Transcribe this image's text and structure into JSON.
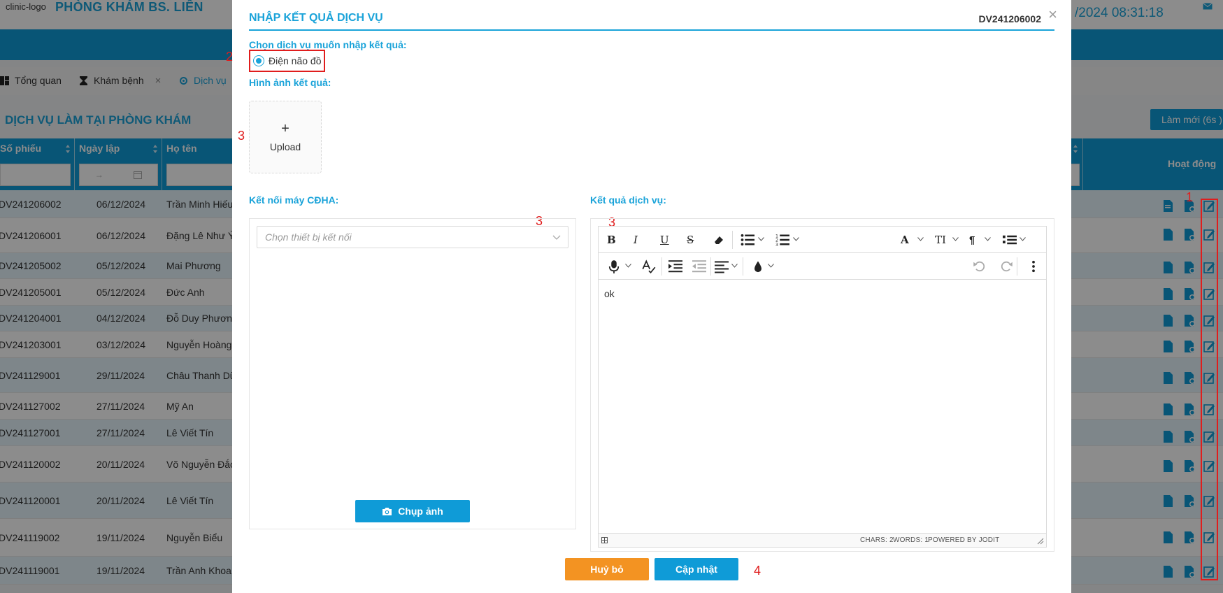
{
  "app": {
    "logo_alt": "clinic-logo",
    "clinic_name": "PHÒNG KHÁM BS. LIÊN",
    "datetime": "/2024 08:31:18"
  },
  "tabs": [
    {
      "label": "Tổng quan"
    },
    {
      "label": "Khám bệnh"
    },
    {
      "label": "Dịch vụ"
    }
  ],
  "page": {
    "title": "DỊCH VỤ LÀM TẠI PHÒNG KHÁM",
    "refresh_label": "Làm mới (6s )"
  },
  "table": {
    "headers": {
      "id": "Số phiếu",
      "date": "Ngày lập",
      "name": "Họ tên",
      "actions": "Hoạt động"
    },
    "date_range_arrow": "→",
    "rows": [
      {
        "id": "DV241206002",
        "date": "06/12/2024",
        "name": "Trần Minh Hiếu"
      },
      {
        "id": "DV241206001",
        "date": "06/12/2024",
        "name": "Đặng Lê Như Ý"
      },
      {
        "id": "DV241205002",
        "date": "05/12/2024",
        "name": "Mai Phương"
      },
      {
        "id": "DV241205001",
        "date": "05/12/2024",
        "name": "Đức Anh"
      },
      {
        "id": "DV241204001",
        "date": "04/12/2024",
        "name": "Đỗ Duy Phương"
      },
      {
        "id": "DV241203001",
        "date": "03/12/2024",
        "name": "Nguyễn Hoàng"
      },
      {
        "id": "DV241129001",
        "date": "29/11/2024",
        "name": "Châu Thanh Dũ"
      },
      {
        "id": "DV241127002",
        "date": "27/11/2024",
        "name": "Mỹ An"
      },
      {
        "id": "DV241127001",
        "date": "27/11/2024",
        "name": "Lê Viết Tín"
      },
      {
        "id": "DV241120002",
        "date": "20/11/2024",
        "name": "Võ Nguyễn Đắc"
      },
      {
        "id": "DV241120001",
        "date": "20/11/2024",
        "name": "Lê Viết Tín"
      },
      {
        "id": "DV241119002",
        "date": "19/11/2024",
        "name": "Nguyễn Biểu"
      },
      {
        "id": "DV241119001",
        "date": "19/11/2024",
        "name": "Trần Anh Khoa"
      }
    ]
  },
  "annotations": {
    "step1": "1",
    "step2": "2",
    "step3": "3",
    "step4": "4"
  },
  "modal": {
    "title": "NHẬP KẾT QUẢ DỊCH VỤ",
    "code": "DV241206002",
    "close": "×",
    "choose_service_label": "Chọn dịch vụ muốn nhập kết quả:",
    "service_option": "Điện não đồ",
    "result_images_label": "Hình ảnh kết quả:",
    "upload_plus": "+",
    "upload_label": "Upload",
    "device_label": "Kết nối máy CĐHA:",
    "device_placeholder": "Chọn thiết bị kết nối",
    "capture_label": "Chụp ảnh",
    "result_label": "Kết quả dịch vụ:",
    "editor": {
      "content": "ok",
      "chars": "CHARS: 2",
      "words": "WORDS: 1",
      "powered": "POWERED BY JODIT",
      "bold": "B",
      "italic": "I",
      "underline": "U",
      "strike": "S",
      "font": "A",
      "size": "TI",
      "paragraph": "¶"
    },
    "cancel_label": "Huỷ bỏ",
    "save_label": "Cập nhật"
  },
  "colors": {
    "accent": "#1aa3d9",
    "primary_button": "#0f9bd7",
    "cancel_button": "#f39322",
    "annotation": "#e01d1d"
  }
}
